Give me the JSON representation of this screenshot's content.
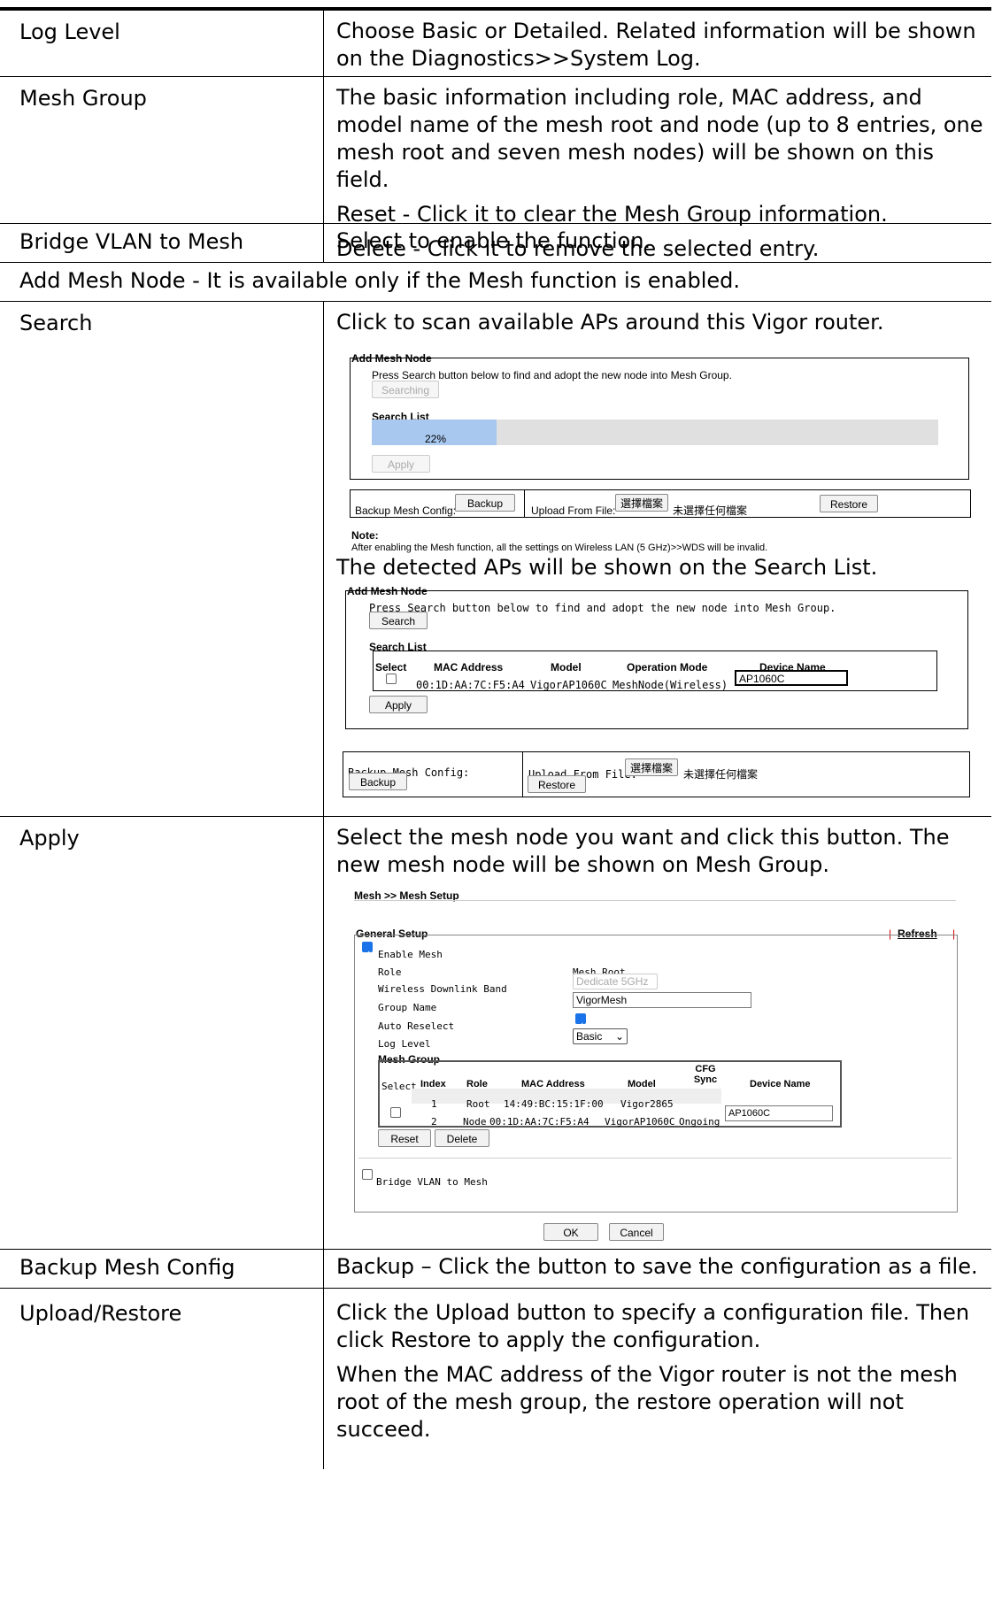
{
  "rows": {
    "log_level": {
      "label": "Log Level",
      "text": "Choose Basic or Detailed. Related information will be shown on the Diagnostics>>System Log."
    },
    "mesh_group": {
      "label": "Mesh Group",
      "p1": "The basic information including role, MAC address, and model name of the mesh root and node (up to 8 entries, one mesh root and seven mesh nodes) will be shown on this field.",
      "p2": "Reset - Click it to clear the Mesh Group information.",
      "p3": "Delete - Click it to remove the selected entry."
    },
    "bridge_vlan": {
      "label": "Bridge VLAN to Mesh",
      "text": "Select to enable the function."
    },
    "add_mesh_node": {
      "text": "Add Mesh Node - It is available only if the Mesh function is enabled."
    },
    "search": {
      "label": "Search",
      "text": "Click to scan available APs around this Vigor router.",
      "text2": "The detected APs will be shown on the Search List."
    },
    "apply": {
      "label": "Apply",
      "text": "Select the mesh node you want and click this button. The new mesh node will be shown on Mesh Group."
    },
    "backup": {
      "label": "Backup Mesh Config",
      "text": "Backup – Click the button to save the configuration as a file."
    },
    "upload": {
      "label": "Upload/Restore",
      "p1": "Click the Upload button to specify a configuration file. Then click Restore to apply the configuration.",
      "p2": "When the MAC address of the Vigor router is not the mesh root of the mesh group, the restore operation will not succeed."
    }
  },
  "shot1": {
    "title": "Add Mesh Node",
    "instr": "Press Search button below to find and adopt the new node into Mesh Group.",
    "searching_btn": "Searching",
    "search_list": "Search List",
    "progress_label": "22%",
    "progress": 0.22,
    "apply_btn": "Apply",
    "backup_label": "Backup Mesh Config:",
    "backup_btn": "Backup",
    "upload_label": "Upload From File:",
    "choose_btn": "選擇檔案",
    "no_file": "未選擇任何檔案",
    "restore_btn": "Restore",
    "note_title": "Note:",
    "note_text": "After enabling the Mesh function, all the settings on Wireless LAN (5 GHz)>>WDS will be invalid."
  },
  "shot2": {
    "title": "Add Mesh Node",
    "instr": "Press Search button below to find and adopt the new node into Mesh Group.",
    "search_btn": "Search",
    "search_list": "Search List",
    "headers": [
      "Select",
      "MAC Address",
      "Model",
      "Operation Mode",
      "Device Name"
    ],
    "row": {
      "mac": "00:1D:AA:7C:F5:A4",
      "model": "VigorAP1060C",
      "mode": "MeshNode(Wireless)",
      "device": "AP1060C"
    },
    "apply_btn": "Apply",
    "backup_label": "Backup Mesh Config:",
    "backup_btn": "Backup",
    "upload_label": "Upload From File:",
    "choose_btn": "選擇檔案",
    "no_file": "未選擇任何檔案",
    "restore_btn": "Restore"
  },
  "shot3": {
    "breadcrumb": "Mesh >> Mesh Setup",
    "general": "General Setup",
    "refresh": "Refresh",
    "enable_mesh": "Enable Mesh",
    "role_label": "Role",
    "role_value": "Mesh Root",
    "band_label": "Wireless Downlink Band",
    "band_value": "Dedicate 5GHz",
    "group_label": "Group Name",
    "group_value": "VigorMesh",
    "auto_label": "Auto Reselect",
    "log_label": "Log Level",
    "log_value": "Basic",
    "mesh_group": "Mesh Group",
    "headers": [
      "Select",
      "Index",
      "Role",
      "MAC Address",
      "Model",
      "CFG Sync",
      "Device Name"
    ],
    "rows": [
      {
        "index": "1",
        "role": "Root",
        "mac": "14:49:BC:15:1F:00",
        "model": "Vigor2865",
        "sync": "",
        "device": ""
      },
      {
        "index": "2",
        "role": "Node",
        "mac": "00:1D:AA:7C:F5:A4",
        "model": "VigorAP1060C",
        "sync": "Ongoing",
        "device": "AP1060C"
      }
    ],
    "reset_btn": "Reset",
    "delete_btn": "Delete",
    "bridge": "Bridge VLAN to Mesh",
    "ok_btn": "OK",
    "cancel_btn": "Cancel"
  }
}
